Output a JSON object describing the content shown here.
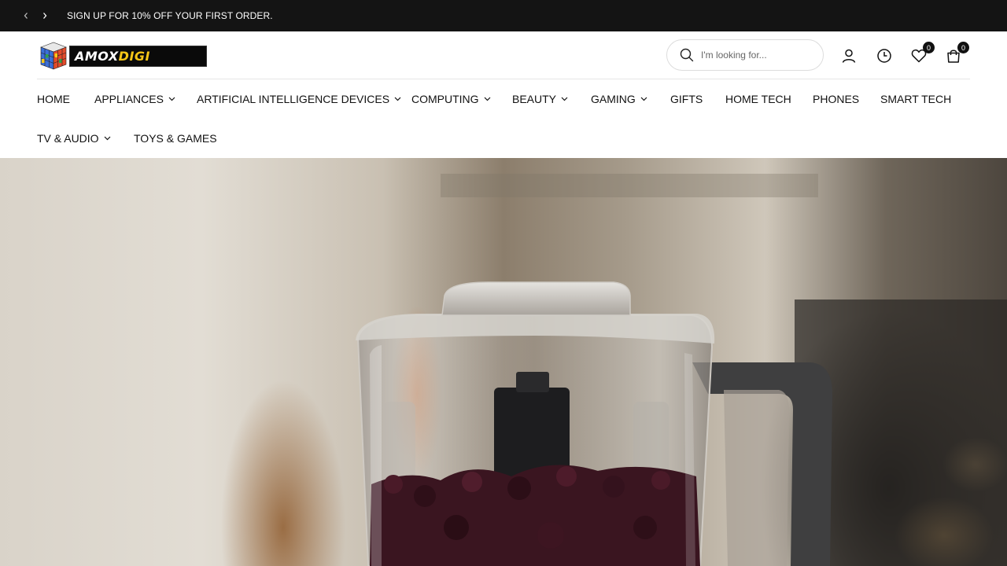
{
  "announcement": {
    "message": "SIGN UP FOR 10% OFF YOUR FIRST ORDER."
  },
  "brand": {
    "name_part1": "AMOX",
    "name_part2": "DIGI",
    "accent_color": "#f6c617"
  },
  "search": {
    "placeholder": "I'm looking for..."
  },
  "header_icons": {
    "account": "user-icon",
    "recently_viewed": "clock-icon",
    "wishlist": "heart-icon",
    "cart": "shopping-bag-icon",
    "wishlist_count": "0",
    "cart_count": "0"
  },
  "nav": {
    "items": [
      {
        "label": "HOME",
        "has_dropdown": false
      },
      {
        "label": "APPLIANCES",
        "has_dropdown": true
      },
      {
        "label": "ARTIFICIAL INTELLIGENCE DEVICES",
        "has_dropdown": true
      },
      {
        "label": "COMPUTING",
        "has_dropdown": true
      },
      {
        "label": "BEAUTY",
        "has_dropdown": true
      },
      {
        "label": "GAMING",
        "has_dropdown": true
      },
      {
        "label": "GIFTS",
        "has_dropdown": false
      },
      {
        "label": "HOME TECH",
        "has_dropdown": false
      },
      {
        "label": "PHONES",
        "has_dropdown": false
      },
      {
        "label": "SMART TECH",
        "has_dropdown": false
      },
      {
        "label": "TV & AUDIO",
        "has_dropdown": true
      },
      {
        "label": "TOYS & GAMES",
        "has_dropdown": false
      }
    ]
  },
  "colors": {
    "announcement_bg": "#141414",
    "text": "#111111"
  }
}
